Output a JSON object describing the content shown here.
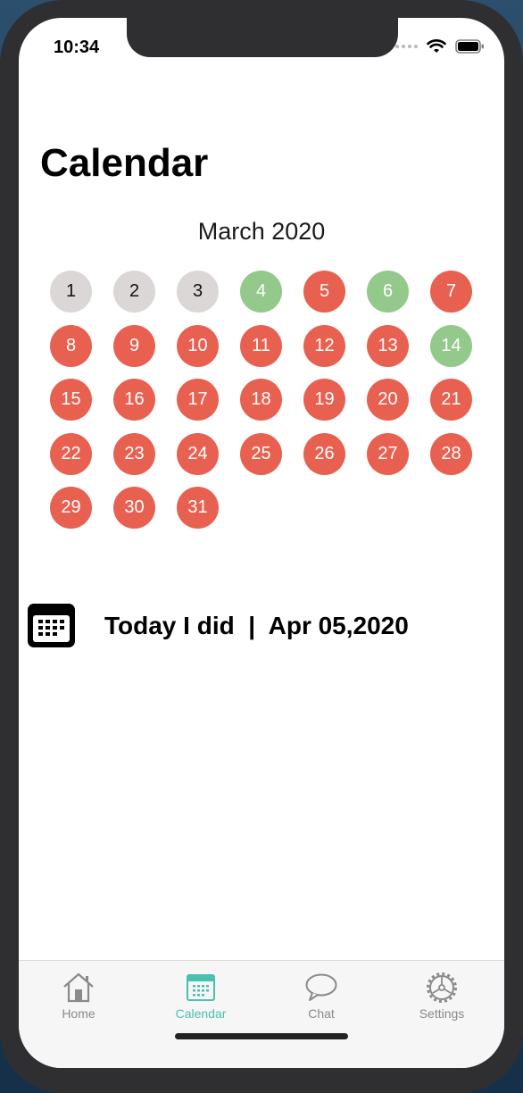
{
  "status_bar": {
    "time": "10:34"
  },
  "page": {
    "title": "Calendar"
  },
  "calendar": {
    "month_label": "March 2020",
    "colors": {
      "past": "#dcd7d7",
      "green": "#93c98a",
      "red": "#e86050"
    },
    "days": [
      {
        "label": "1",
        "status": "past"
      },
      {
        "label": "2",
        "status": "past"
      },
      {
        "label": "3",
        "status": "past"
      },
      {
        "label": "4",
        "status": "green"
      },
      {
        "label": "5",
        "status": "red"
      },
      {
        "label": "6",
        "status": "green"
      },
      {
        "label": "7",
        "status": "red"
      },
      {
        "label": "8",
        "status": "red"
      },
      {
        "label": "9",
        "status": "red"
      },
      {
        "label": "10",
        "status": "red"
      },
      {
        "label": "11",
        "status": "red"
      },
      {
        "label": "12",
        "status": "red"
      },
      {
        "label": "13",
        "status": "red"
      },
      {
        "label": "14",
        "status": "green"
      },
      {
        "label": "15",
        "status": "red"
      },
      {
        "label": "16",
        "status": "red"
      },
      {
        "label": "17",
        "status": "red"
      },
      {
        "label": "18",
        "status": "red"
      },
      {
        "label": "19",
        "status": "red"
      },
      {
        "label": "20",
        "status": "red"
      },
      {
        "label": "21",
        "status": "red"
      },
      {
        "label": "22",
        "status": "red"
      },
      {
        "label": "23",
        "status": "red"
      },
      {
        "label": "24",
        "status": "red"
      },
      {
        "label": "25",
        "status": "red"
      },
      {
        "label": "26",
        "status": "red"
      },
      {
        "label": "27",
        "status": "red"
      },
      {
        "label": "28",
        "status": "red"
      },
      {
        "label": "29",
        "status": "red"
      },
      {
        "label": "30",
        "status": "red"
      },
      {
        "label": "31",
        "status": "red"
      }
    ]
  },
  "today": {
    "icon": "calendar-icon",
    "text": "Today I did  |  Apr 05,2020"
  },
  "tabbar": {
    "active_color": "#4bbfb0",
    "inactive_color": "#8a8a8a",
    "tabs": [
      {
        "label": "Home",
        "icon": "home-icon",
        "active": false
      },
      {
        "label": "Calendar",
        "icon": "calendar-icon",
        "active": true
      },
      {
        "label": "Chat",
        "icon": "chat-icon",
        "active": false
      },
      {
        "label": "Settings",
        "icon": "settings-icon",
        "active": false
      }
    ]
  }
}
